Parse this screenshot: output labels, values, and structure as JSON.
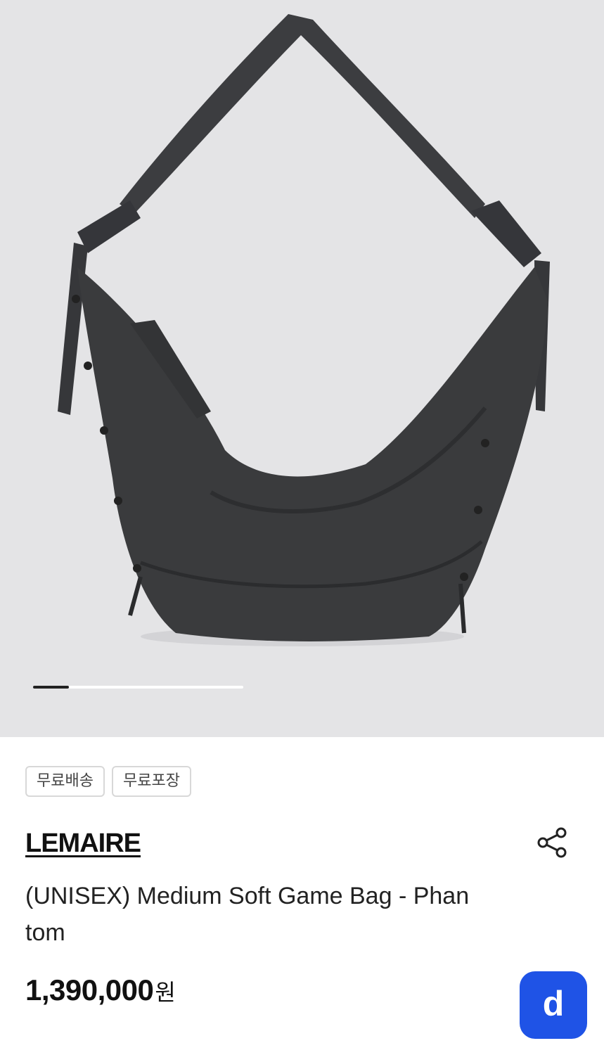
{
  "gallery": {
    "current_index": 1,
    "progress_fraction": 0.17
  },
  "tags": [
    "무료배송",
    "무료포장"
  ],
  "product": {
    "brand": "LEMAIRE",
    "name": "(UNISEX) Medium Soft Game Bag - Phantom",
    "price": "1,390,000",
    "currency": "원"
  },
  "icons": {
    "share": "share-icon",
    "app_badge_letter": "d"
  },
  "colors": {
    "hero_background": "#e4e4e6",
    "bag": "#3a3b3d",
    "badge": "#1f53e6"
  }
}
